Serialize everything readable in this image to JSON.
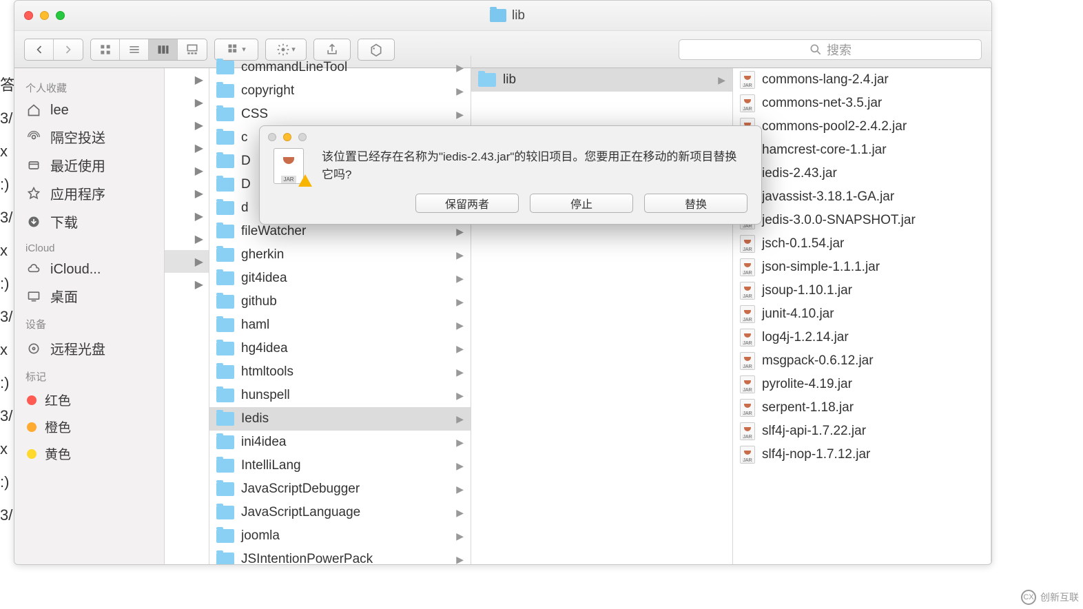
{
  "window": {
    "title": "lib"
  },
  "toolbar": {
    "search_placeholder": "搜索"
  },
  "sidebar": {
    "sections": [
      {
        "header": "个人收藏",
        "items": [
          {
            "icon": "home",
            "label": "lee"
          },
          {
            "icon": "airdrop",
            "label": "隔空投送"
          },
          {
            "icon": "recents",
            "label": "最近使用"
          },
          {
            "icon": "apps",
            "label": "应用程序"
          },
          {
            "icon": "downloads",
            "label": "下载"
          }
        ]
      },
      {
        "header": "iCloud",
        "items": [
          {
            "icon": "cloud",
            "label": "iCloud..."
          },
          {
            "icon": "desktop",
            "label": "桌面"
          }
        ]
      },
      {
        "header": "设备",
        "items": [
          {
            "icon": "disc",
            "label": "远程光盘"
          }
        ]
      },
      {
        "header": "标记",
        "tags": [
          {
            "color": "#ff5b52",
            "label": "红色"
          },
          {
            "color": "#ffab31",
            "label": "橙色"
          },
          {
            "color": "#ffd92e",
            "label": "黄色"
          }
        ]
      }
    ]
  },
  "col2": [
    {
      "label": "commandLineTool",
      "arrow": true
    },
    {
      "label": "copyright",
      "arrow": true
    },
    {
      "label": "CSS",
      "arrow": true
    },
    {
      "label": "c",
      "arrow": true
    },
    {
      "label": "D",
      "arrow": true
    },
    {
      "label": "D",
      "arrow": true
    },
    {
      "label": "d",
      "arrow": true
    },
    {
      "label": "fileWatcher",
      "arrow": true
    },
    {
      "label": "gherkin",
      "arrow": true
    },
    {
      "label": "git4idea",
      "arrow": true
    },
    {
      "label": "github",
      "arrow": true
    },
    {
      "label": "haml",
      "arrow": true
    },
    {
      "label": "hg4idea",
      "arrow": true
    },
    {
      "label": "htmltools",
      "arrow": true
    },
    {
      "label": "hunspell",
      "arrow": true
    },
    {
      "label": "Iedis",
      "arrow": true,
      "selected": true
    },
    {
      "label": "ini4idea",
      "arrow": true
    },
    {
      "label": "IntelliLang",
      "arrow": true
    },
    {
      "label": "JavaScriptDebugger",
      "arrow": true
    },
    {
      "label": "JavaScriptLanguage",
      "arrow": true
    },
    {
      "label": "joomla",
      "arrow": true
    },
    {
      "label": "JSIntentionPowerPack",
      "arrow": true
    }
  ],
  "col3": [
    {
      "label": "lib",
      "arrow": true,
      "selected": true
    }
  ],
  "col4": [
    {
      "label": "commons-lang-2.4.jar"
    },
    {
      "label": "commons-net-3.5.jar"
    },
    {
      "label": "commons-pool2-2.4.2.jar"
    },
    {
      "label": "hamcrest-core-1.1.jar"
    },
    {
      "label": "iedis-2.43.jar"
    },
    {
      "label": "javassist-3.18.1-GA.jar"
    },
    {
      "label": "jedis-3.0.0-SNAPSHOT.jar"
    },
    {
      "label": "jsch-0.1.54.jar"
    },
    {
      "label": "json-simple-1.1.1.jar"
    },
    {
      "label": "jsoup-1.10.1.jar"
    },
    {
      "label": "junit-4.10.jar"
    },
    {
      "label": "log4j-1.2.14.jar"
    },
    {
      "label": "msgpack-0.6.12.jar"
    },
    {
      "label": "pyrolite-4.19.jar"
    },
    {
      "label": "serpent-1.18.jar"
    },
    {
      "label": "slf4j-api-1.7.22.jar"
    },
    {
      "label": "slf4j-nop-1.7.12.jar"
    }
  ],
  "dialog": {
    "message": "该位置已经存在名称为\"iedis-2.43.jar\"的较旧项目。您要用正在移动的新项目替换它吗?",
    "keep_both": "保留两者",
    "stop": "停止",
    "replace": "替换"
  },
  "watermark": "创新互联"
}
